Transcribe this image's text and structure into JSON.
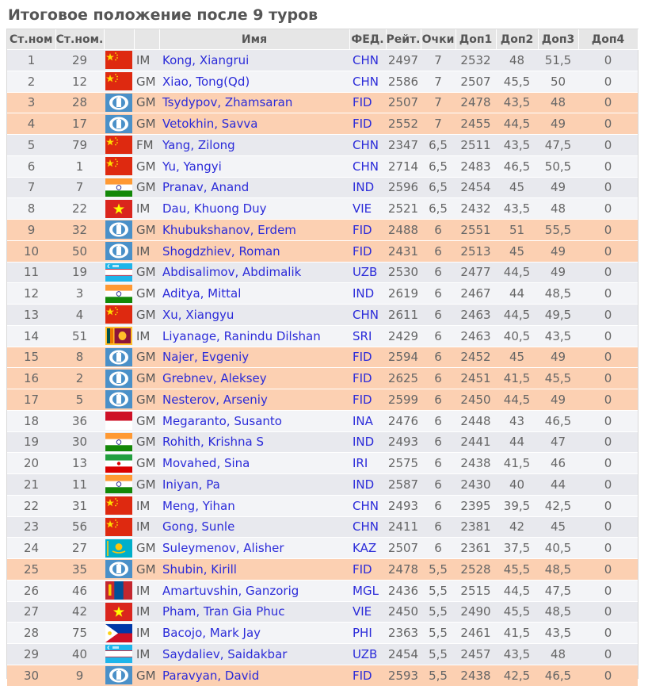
{
  "page_title": "Итоговое положение после 9 туров",
  "table": {
    "headers": {
      "rank": "Ст.ном",
      "start_no": "Ст.ном.",
      "flag": "",
      "title": "",
      "name": "Имя",
      "fed": "ФЕД.",
      "rating": "Рейт.",
      "points": "Очки",
      "tb1": "Доп1",
      "tb2": "Доп2",
      "tb3": "Доп3",
      "tb4": "Доп4"
    },
    "rows": [
      {
        "rank": "1",
        "sno": "29",
        "flag": "china",
        "title": "IM",
        "name": "Kong, Xiangrui",
        "fed": "CHN",
        "rtg": "2497",
        "pts": "7",
        "tb1": "2532",
        "tb2": "48",
        "tb3": "51,5",
        "tb4": "0",
        "hl": false
      },
      {
        "rank": "2",
        "sno": "12",
        "flag": "china",
        "title": "GM",
        "name": "Xiao, Tong(Qd)",
        "fed": "CHN",
        "rtg": "2586",
        "pts": "7",
        "tb1": "2507",
        "tb2": "45,5",
        "tb3": "50",
        "tb4": "0",
        "hl": false
      },
      {
        "rank": "3",
        "sno": "28",
        "flag": "fide",
        "title": "GM",
        "name": "Tsydypov, Zhamsaran",
        "fed": "FID",
        "rtg": "2507",
        "pts": "7",
        "tb1": "2478",
        "tb2": "43,5",
        "tb3": "48",
        "tb4": "0",
        "hl": true
      },
      {
        "rank": "4",
        "sno": "17",
        "flag": "fide",
        "title": "GM",
        "name": "Vetokhin, Savva",
        "fed": "FID",
        "rtg": "2552",
        "pts": "7",
        "tb1": "2455",
        "tb2": "44,5",
        "tb3": "49",
        "tb4": "0",
        "hl": true
      },
      {
        "rank": "5",
        "sno": "79",
        "flag": "china",
        "title": "FM",
        "name": "Yang, Zilong",
        "fed": "CHN",
        "rtg": "2347",
        "pts": "6,5",
        "tb1": "2511",
        "tb2": "43,5",
        "tb3": "47,5",
        "tb4": "0",
        "hl": false
      },
      {
        "rank": "6",
        "sno": "1",
        "flag": "china",
        "title": "GM",
        "name": "Yu, Yangyi",
        "fed": "CHN",
        "rtg": "2714",
        "pts": "6,5",
        "tb1": "2483",
        "tb2": "46,5",
        "tb3": "50,5",
        "tb4": "0",
        "hl": false
      },
      {
        "rank": "7",
        "sno": "7",
        "flag": "india",
        "title": "GM",
        "name": "Pranav, Anand",
        "fed": "IND",
        "rtg": "2596",
        "pts": "6,5",
        "tb1": "2454",
        "tb2": "45",
        "tb3": "49",
        "tb4": "0",
        "hl": false
      },
      {
        "rank": "8",
        "sno": "22",
        "flag": "vietnam",
        "title": "IM",
        "name": "Dau, Khuong Duy",
        "fed": "VIE",
        "rtg": "2521",
        "pts": "6,5",
        "tb1": "2432",
        "tb2": "43,5",
        "tb3": "48",
        "tb4": "0",
        "hl": false
      },
      {
        "rank": "9",
        "sno": "32",
        "flag": "fide",
        "title": "GM",
        "name": "Khubukshanov, Erdem",
        "fed": "FID",
        "rtg": "2488",
        "pts": "6",
        "tb1": "2551",
        "tb2": "51",
        "tb3": "55,5",
        "tb4": "0",
        "hl": true
      },
      {
        "rank": "10",
        "sno": "50",
        "flag": "fide",
        "title": "IM",
        "name": "Shogdzhiev, Roman",
        "fed": "FID",
        "rtg": "2431",
        "pts": "6",
        "tb1": "2513",
        "tb2": "45",
        "tb3": "49",
        "tb4": "0",
        "hl": true
      },
      {
        "rank": "11",
        "sno": "19",
        "flag": "uzbekistan",
        "title": "GM",
        "name": "Abdisalimov, Abdimalik",
        "fed": "UZB",
        "rtg": "2530",
        "pts": "6",
        "tb1": "2477",
        "tb2": "44,5",
        "tb3": "49",
        "tb4": "0",
        "hl": false
      },
      {
        "rank": "12",
        "sno": "3",
        "flag": "india",
        "title": "GM",
        "name": "Aditya, Mittal",
        "fed": "IND",
        "rtg": "2619",
        "pts": "6",
        "tb1": "2467",
        "tb2": "44",
        "tb3": "48,5",
        "tb4": "0",
        "hl": false
      },
      {
        "rank": "13",
        "sno": "4",
        "flag": "china",
        "title": "GM",
        "name": "Xu, Xiangyu",
        "fed": "CHN",
        "rtg": "2611",
        "pts": "6",
        "tb1": "2463",
        "tb2": "44,5",
        "tb3": "49,5",
        "tb4": "0",
        "hl": false
      },
      {
        "rank": "14",
        "sno": "51",
        "flag": "srilanka",
        "title": "IM",
        "name": "Liyanage, Ranindu Dilshan",
        "fed": "SRI",
        "rtg": "2429",
        "pts": "6",
        "tb1": "2463",
        "tb2": "40,5",
        "tb3": "43,5",
        "tb4": "0",
        "hl": false
      },
      {
        "rank": "15",
        "sno": "8",
        "flag": "fide",
        "title": "GM",
        "name": "Najer, Evgeniy",
        "fed": "FID",
        "rtg": "2594",
        "pts": "6",
        "tb1": "2452",
        "tb2": "45",
        "tb3": "49",
        "tb4": "0",
        "hl": true
      },
      {
        "rank": "16",
        "sno": "2",
        "flag": "fide",
        "title": "GM",
        "name": "Grebnev, Aleksey",
        "fed": "FID",
        "rtg": "2625",
        "pts": "6",
        "tb1": "2451",
        "tb2": "41,5",
        "tb3": "45,5",
        "tb4": "0",
        "hl": true
      },
      {
        "rank": "17",
        "sno": "5",
        "flag": "fide",
        "title": "GM",
        "name": "Nesterov, Arseniy",
        "fed": "FID",
        "rtg": "2599",
        "pts": "6",
        "tb1": "2450",
        "tb2": "44,5",
        "tb3": "49",
        "tb4": "0",
        "hl": true
      },
      {
        "rank": "18",
        "sno": "36",
        "flag": "indonesia",
        "title": "GM",
        "name": "Megaranto, Susanto",
        "fed": "INA",
        "rtg": "2476",
        "pts": "6",
        "tb1": "2448",
        "tb2": "43",
        "tb3": "46,5",
        "tb4": "0",
        "hl": false
      },
      {
        "rank": "19",
        "sno": "30",
        "flag": "india",
        "title": "GM",
        "name": "Rohith, Krishna S",
        "fed": "IND",
        "rtg": "2493",
        "pts": "6",
        "tb1": "2441",
        "tb2": "44",
        "tb3": "47",
        "tb4": "0",
        "hl": false
      },
      {
        "rank": "20",
        "sno": "13",
        "flag": "iran",
        "title": "GM",
        "name": "Movahed, Sina",
        "fed": "IRI",
        "rtg": "2575",
        "pts": "6",
        "tb1": "2438",
        "tb2": "41,5",
        "tb3": "46",
        "tb4": "0",
        "hl": false
      },
      {
        "rank": "21",
        "sno": "11",
        "flag": "india",
        "title": "GM",
        "name": "Iniyan, Pa",
        "fed": "IND",
        "rtg": "2587",
        "pts": "6",
        "tb1": "2430",
        "tb2": "40",
        "tb3": "44",
        "tb4": "0",
        "hl": false
      },
      {
        "rank": "22",
        "sno": "31",
        "flag": "china",
        "title": "IM",
        "name": "Meng, Yihan",
        "fed": "CHN",
        "rtg": "2493",
        "pts": "6",
        "tb1": "2395",
        "tb2": "39,5",
        "tb3": "42,5",
        "tb4": "0",
        "hl": false
      },
      {
        "rank": "23",
        "sno": "56",
        "flag": "china",
        "title": "IM",
        "name": "Gong, Sunle",
        "fed": "CHN",
        "rtg": "2411",
        "pts": "6",
        "tb1": "2381",
        "tb2": "42",
        "tb3": "45",
        "tb4": "0",
        "hl": false
      },
      {
        "rank": "24",
        "sno": "27",
        "flag": "kazakhstan",
        "title": "GM",
        "name": "Suleymenov, Alisher",
        "fed": "KAZ",
        "rtg": "2507",
        "pts": "6",
        "tb1": "2361",
        "tb2": "37,5",
        "tb3": "40,5",
        "tb4": "0",
        "hl": false
      },
      {
        "rank": "25",
        "sno": "35",
        "flag": "fide",
        "title": "GM",
        "name": "Shubin, Kirill",
        "fed": "FID",
        "rtg": "2478",
        "pts": "5,5",
        "tb1": "2528",
        "tb2": "45,5",
        "tb3": "48,5",
        "tb4": "0",
        "hl": true
      },
      {
        "rank": "26",
        "sno": "46",
        "flag": "mongolia",
        "title": "IM",
        "name": "Amartuvshin, Ganzorig",
        "fed": "MGL",
        "rtg": "2436",
        "pts": "5,5",
        "tb1": "2515",
        "tb2": "44,5",
        "tb3": "47,5",
        "tb4": "0",
        "hl": false
      },
      {
        "rank": "27",
        "sno": "42",
        "flag": "vietnam",
        "title": "IM",
        "name": "Pham, Tran Gia Phuc",
        "fed": "VIE",
        "rtg": "2450",
        "pts": "5,5",
        "tb1": "2490",
        "tb2": "45,5",
        "tb3": "48,5",
        "tb4": "0",
        "hl": false
      },
      {
        "rank": "28",
        "sno": "75",
        "flag": "philippines",
        "title": "IM",
        "name": "Bacojo, Mark Jay",
        "fed": "PHI",
        "rtg": "2363",
        "pts": "5,5",
        "tb1": "2461",
        "tb2": "41,5",
        "tb3": "43,5",
        "tb4": "0",
        "hl": false
      },
      {
        "rank": "29",
        "sno": "40",
        "flag": "uzbekistan",
        "title": "IM",
        "name": "Saydaliev, Saidakbar",
        "fed": "UZB",
        "rtg": "2454",
        "pts": "5,5",
        "tb1": "2457",
        "tb2": "43,5",
        "tb3": "48",
        "tb4": "0",
        "hl": false
      },
      {
        "rank": "30",
        "sno": "9",
        "flag": "fide",
        "title": "GM",
        "name": "Paravyan, David",
        "fed": "FID",
        "rtg": "2593",
        "pts": "5,5",
        "tb1": "2438",
        "tb2": "42,5",
        "tb3": "46,5",
        "tb4": "0",
        "hl": true
      }
    ]
  },
  "colors": {
    "highlight_row": "#fcd0b2",
    "odd_row": "#e8e9ee",
    "even_row": "#f3f4f7",
    "link": "#2b2bd9",
    "header_bg": "#e6e6e6"
  }
}
